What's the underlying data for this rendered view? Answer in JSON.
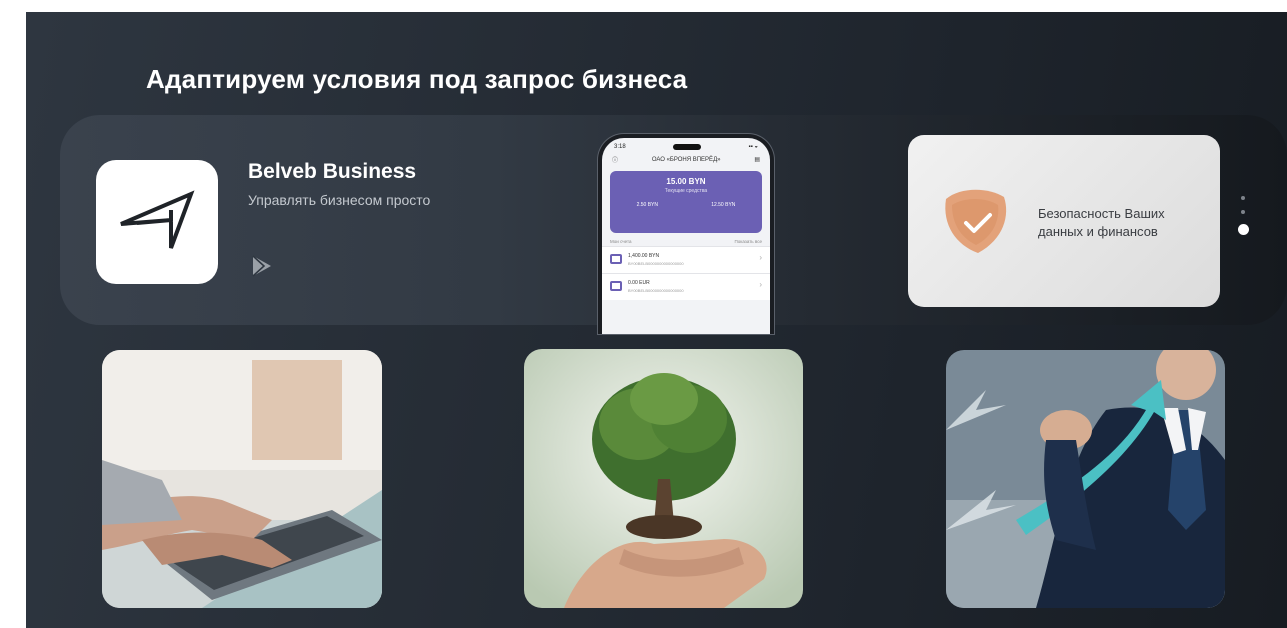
{
  "headline": "Адаптируем условия под запрос бизнеса",
  "app": {
    "name": "Belveb Business",
    "tagline": "Управлять бизнесом просто",
    "store_icon": "google-play-icon"
  },
  "phone": {
    "time": "3:18",
    "bank": "ОАО «БРОНЯ ВПЕРЁД»",
    "balance": "15.00 BYN",
    "balance_label": "Текущие средства",
    "stat_left": "2.50 BYN",
    "stat_right": "12.50 BYN",
    "list_label": "Мои счета",
    "list_right": "Показать все",
    "accounts": [
      {
        "amount": "1,400.00 BYN",
        "number": "BY00BELB0000000000000000"
      },
      {
        "amount": "0.00 EUR",
        "number": "BY00BELB0000000000000000"
      }
    ]
  },
  "security": {
    "text": "Безопасность Ваших данных и финансов",
    "icon": "shield-check-icon"
  },
  "carousel": {
    "pages": 3,
    "active": 3
  },
  "photos": [
    {
      "name": "laptop-typing-photo"
    },
    {
      "name": "tree-in-hands-photo"
    },
    {
      "name": "growth-arrow-photo"
    }
  ],
  "colors": {
    "background": "#262d36",
    "banner": "#3a424d",
    "phone_accent": "#6b60b4",
    "security_icon": "#e3a27a"
  }
}
